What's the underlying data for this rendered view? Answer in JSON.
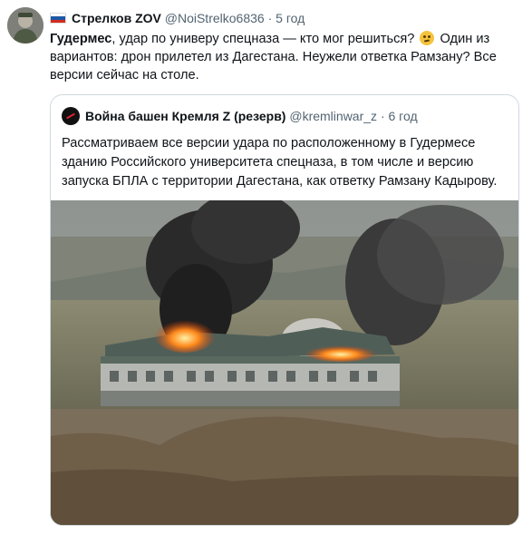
{
  "tweet": {
    "author_name": "Стрелков ZOV",
    "handle": "@NoiStrelko6836",
    "separator": "·",
    "time": "5 год",
    "text_bold": "Гудермес",
    "text_part1": ", удар по универу спецназа — кто мог решиться?",
    "text_part2": " Один из вариантов: дрон прилетел из Дагестана. Неужели ответка Рамзану? Все версии сейчас на столе."
  },
  "quoted": {
    "author_name": "Война башен Кремля Z (резерв)",
    "handle": "@kremlinwar_z",
    "separator": "·",
    "time": "6 год",
    "text": "Рассматриваем все версии удара по расположенному в Гудермесе зданию Российского университета спецназа, в том числе и версию запуска БПЛА с территории Дагестана, как ответку Рамзану Кадырову."
  },
  "colors": {
    "text": "#0f1419",
    "muted": "#536471",
    "border": "#cfd9de",
    "flag_white": "#ffffff",
    "flag_blue": "#1c57a5",
    "flag_red": "#d52b1e"
  },
  "icons": [
    "russian-flag-icon",
    "thinking-face-icon"
  ]
}
